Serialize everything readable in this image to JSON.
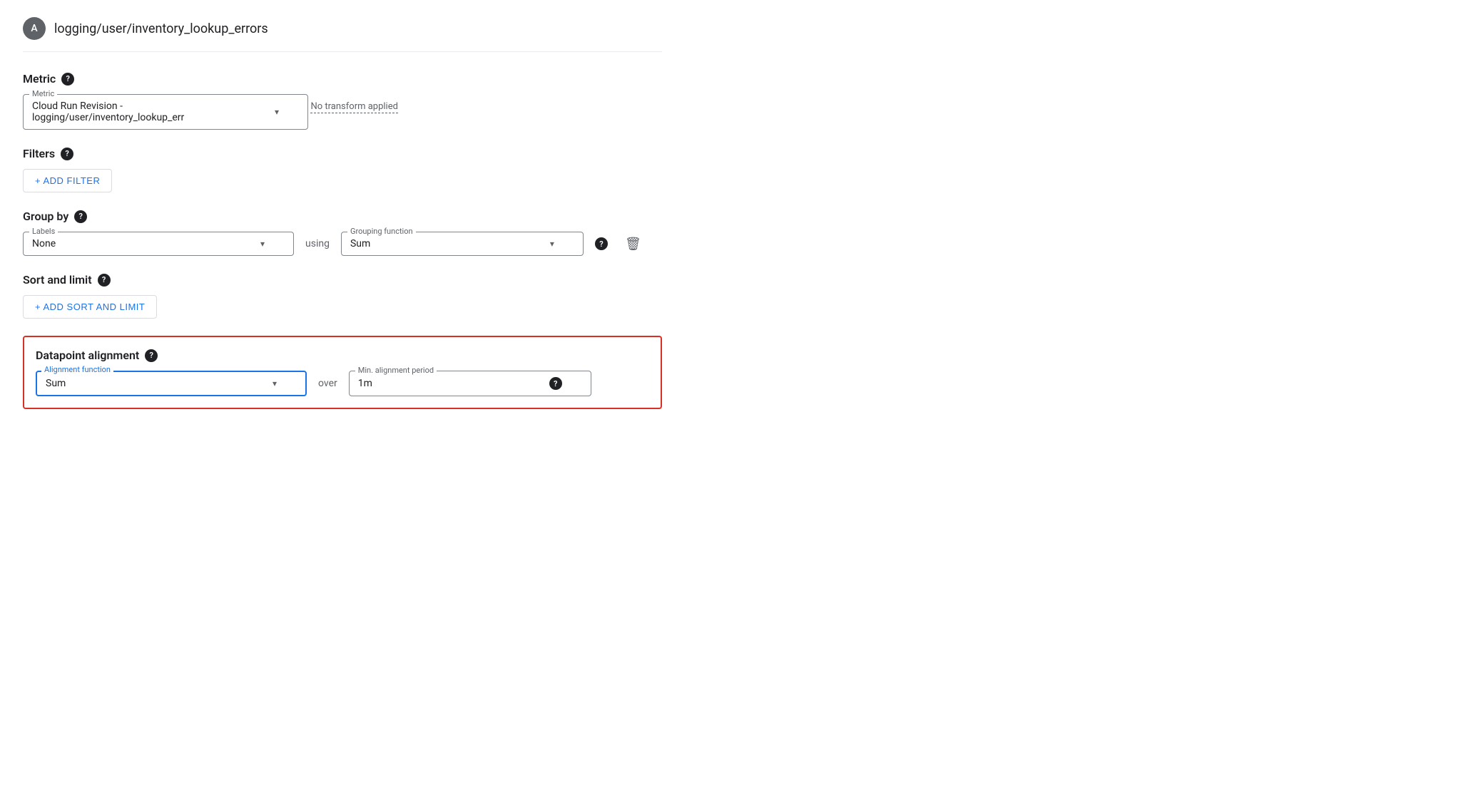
{
  "header": {
    "avatar_initial": "A",
    "title": "logging/user/inventory_lookup_errors"
  },
  "metric_section": {
    "label": "Metric",
    "field_label": "Metric",
    "selected_value": "Cloud Run Revision - logging/user/inventory_lookup_err",
    "no_transform_text": "No transform applied"
  },
  "filters_section": {
    "label": "Filters",
    "add_filter_button": "+ ADD FILTER"
  },
  "group_by_section": {
    "label": "Group by",
    "labels_field_label": "Labels",
    "labels_value": "None",
    "using_text": "using",
    "grouping_function_label": "Grouping function",
    "grouping_function_value": "Sum"
  },
  "sort_limit_section": {
    "label": "Sort and limit",
    "add_button": "+ ADD SORT AND LIMIT"
  },
  "datapoint_section": {
    "label": "Datapoint alignment",
    "alignment_function_label": "Alignment function",
    "alignment_value": "Sum",
    "over_text": "over",
    "min_alignment_label": "Min. alignment period",
    "min_alignment_value": "1m"
  },
  "icons": {
    "help": "?",
    "chevron": "▾",
    "plus": "+",
    "trash": "🗑"
  }
}
